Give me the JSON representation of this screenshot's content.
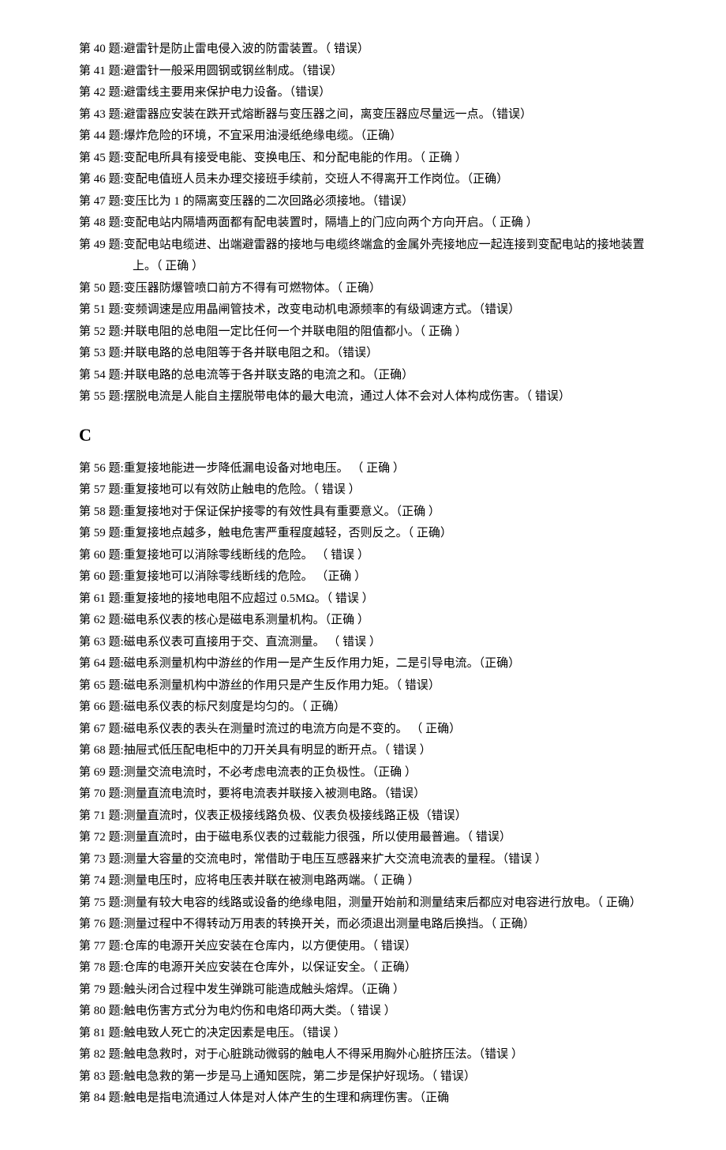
{
  "groupA": [
    {
      "n": "40",
      "t": "避雷针是防止雷电侵入波的防雷装置。（ 错误）"
    },
    {
      "n": "41",
      "t": "避雷针一般采用圆钢或钢丝制成。（错误）"
    },
    {
      "n": "42",
      "t": "避雷线主要用来保护电力设备。（错误）"
    },
    {
      "n": "43",
      "t": "避雷器应安装在跌开式熔断器与变压器之间，离变压器应尽量远一点。（错误）"
    },
    {
      "n": "44",
      "t": "爆炸危险的环境，不宜采用油浸纸绝缘电缆。（正确）"
    },
    {
      "n": "45",
      "t": "变配电所具有接受电能、变换电压、和分配电能的作用。（ 正确 ）"
    },
    {
      "n": "46",
      "t": "变配电值班人员未办理交接班手续前，交班人不得离开工作岗位。（正确）"
    },
    {
      "n": "47",
      "t": "变压比为 1 的隔离变压器的二次回路必须接地。（错误）"
    },
    {
      "n": "48",
      "t": "变配电站内隔墙两面都有配电装置时，隔墙上的门应向两个方向开启。（ 正确 ）"
    },
    {
      "n": "49",
      "t": "变配电站电缆进、出端避雷器的接地与电缆终端盒的金属外壳接地应一起连接到变配电站的接地装置",
      "cont": "上。（ 正确 ）"
    },
    {
      "n": "50",
      "t": "变压器防爆管喷口前方不得有可燃物体。（ 正确）"
    },
    {
      "n": "51",
      "t": "变频调速是应用晶闸管技术，改变电动机电源频率的有级调速方式。（错误）"
    },
    {
      "n": "52",
      "t": "并联电阻的总电阻一定比任何一个并联电阻的阻值都小。（ 正确 ）"
    },
    {
      "n": "53",
      "t": "并联电路的总电阻等于各并联电阻之和。（错误）"
    },
    {
      "n": "54",
      "t": "并联电路的总电流等于各并联支路的电流之和。（正确）"
    },
    {
      "n": "55",
      "t": "摆脱电流是人能自主摆脱带电体的最大电流，通过人体不会对人体构成伤害。（ 错误）"
    }
  ],
  "sectionHeading": "C",
  "groupB": [
    {
      "n": "56",
      "t": "重复接地能进一步降低漏电设备对地电压。 （  正确 ）"
    },
    {
      "n": "57",
      "t": "重复接地可以有效防止触电的危险。（  错误 ）"
    },
    {
      "n": "58",
      "t": "重复接地对于保证保护接零的有效性具有重要意义。（正确  ）"
    },
    {
      "n": "59",
      "t": "重复接地点越多，触电危害严重程度越轻，否则反之。（  正确）"
    },
    {
      "n": "60",
      "t": "重复接地可以消除零线断线的危险。 （ 错误 ）"
    },
    {
      "n": "60",
      "t": "重复接地可以消除零线断线的危险。 （正确  ）"
    },
    {
      "n": "61",
      "t": "重复接地的接地电阻不应超过 0.5MΩ。（  错误 ）"
    },
    {
      "n": "62",
      "t": "磁电系仪表的核心是磁电系测量机构。（正确   ）"
    },
    {
      "n": "63",
      "t": "磁电系仪表可直接用于交、直流测量。   （  错误 ）"
    },
    {
      "n": "64",
      "t": "磁电系测量机构中游丝的作用一是产生反作用力矩，二是引导电流。（正确）"
    },
    {
      "n": "65",
      "t": "磁电系测量机构中游丝的作用只是产生反作用力矩。（ 错误）"
    },
    {
      "n": "66",
      "t": "磁电系仪表的标尺刻度是均匀的。（ 正确）"
    },
    {
      "n": "67",
      "t": "磁电系仪表的表头在测量时流过的电流方向是不变的。   （ 正确）"
    },
    {
      "n": "68",
      "t": "抽屉式低压配电柜中的刀开关具有明显的断开点。（  错误 ）"
    },
    {
      "n": "69",
      "t": "测量交流电流时，不必考虑电流表的正负极性。（正确  ）"
    },
    {
      "n": "70",
      "t": "测量直流电流时，要将电流表并联接入被测电路。（错误）"
    },
    {
      "n": "71",
      "t": "测量直流时，仪表正极接线路负极、仪表负极接线路正极（错误）"
    },
    {
      "n": "72",
      "t": "测量直流时，由于磁电系仪表的过载能力很强，所以使用最普遍。（   错误）"
    },
    {
      "n": "73",
      "t": "测量大容量的交流电时，常借助于电压互感器来扩大交流电流表的量程。（错误   ）"
    },
    {
      "n": "74",
      "t": "测量电压时，应将电压表并联在被测电路两端。（  正确 ）"
    },
    {
      "n": "75",
      "t": "测量有较大电容的线路或设备的绝缘电阻，测量开始前和测量结束后都应对电容进行放电。（ 正确）"
    },
    {
      "n": "76",
      "t": "测量过程中不得转动万用表的转换开关，而必须退出测量电路后换挡。（ 正确）"
    },
    {
      "n": "77",
      "t": "仓库的电源开关应安装在仓库内，以方便使用。（   错误）"
    },
    {
      "n": "78",
      "t": "仓库的电源开关应安装在仓库外，以保证安全。（ 正确）"
    },
    {
      "n": "79",
      "t": "触头闭合过程中发生弹跳可能造成触头熔焊。（正确  ）"
    },
    {
      "n": "80",
      "t": "触电伤害方式分为电灼伤和电烙印两大类。（ 错误 ）"
    },
    {
      "n": "81",
      "t": "触电致人死亡的决定因素是电压。（错误 ）"
    },
    {
      "n": "82",
      "t": "触电急救时，对于心脏跳动微弱的触电人不得采用胸外心脏挤压法。（错误  ）"
    },
    {
      "n": "83",
      "t": "触电急救的第一步是马上通知医院，第二步是保护好现场。（ 错误）"
    },
    {
      "n": "84",
      "t": " 触电是指电流通过人体是对人体产生的生理和病理伤害。（正确"
    }
  ]
}
